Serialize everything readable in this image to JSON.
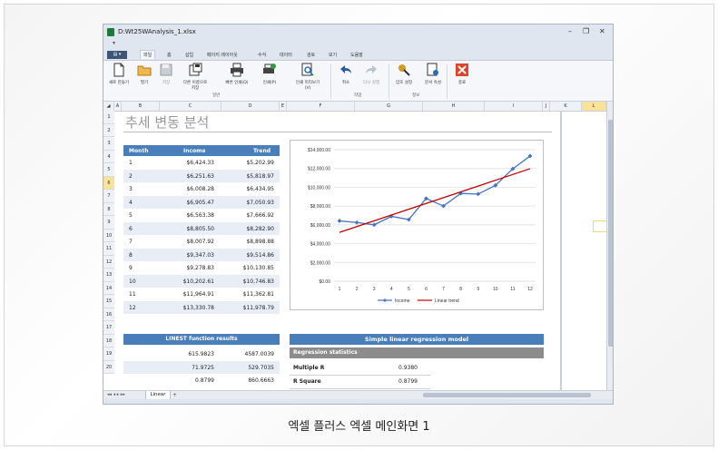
{
  "window": {
    "title": "D:Wt25WAnalysis_1.xlsx",
    "controls": [
      "–",
      "❐",
      "✕"
    ]
  },
  "qat_label": "▾",
  "tabs": {
    "file": "▤ ▾",
    "items": [
      "파일",
      "홈",
      "삽입",
      "페이지 레이아웃",
      "수식",
      "데이터",
      "검토",
      "보기",
      "도움말"
    ],
    "active_index": 0
  },
  "ribbon": {
    "buttons": [
      {
        "label": "새로 만들기",
        "icon": "new-document-icon"
      },
      {
        "label": "열기",
        "icon": "folder-open-icon"
      },
      {
        "label": "저장",
        "icon": "save-icon"
      },
      {
        "label": "다른 이름으로 저장",
        "icon": "save-as-icon"
      },
      {
        "label": "빠른 인쇄(Q)",
        "icon": "printer-icon"
      },
      {
        "label": "인쇄(P)",
        "icon": "print-settings-icon"
      },
      {
        "label": "인쇄 미리보기(V)",
        "icon": "print-preview-icon"
      },
      {
        "label": "취소",
        "icon": "undo-icon"
      },
      {
        "label": "다시 실행",
        "icon": "redo-icon"
      },
      {
        "label": "암호 설정",
        "icon": "password-key-icon"
      },
      {
        "label": "문서 속성",
        "icon": "document-properties-icon"
      },
      {
        "label": "종료",
        "icon": "close-app-icon"
      }
    ],
    "groups": [
      "일반",
      "작업",
      "정보"
    ]
  },
  "columns": [
    "A",
    "B",
    "C",
    "D",
    "E",
    "F",
    "G",
    "H",
    "I",
    "J",
    "K",
    "L"
  ],
  "selected_column": "L",
  "rows": [
    "1",
    "2",
    "3",
    "4",
    "5",
    "6",
    "7",
    "8",
    "9",
    "10",
    "11",
    "12",
    "13",
    "14",
    "15",
    "16",
    "17",
    "18",
    "19",
    "20"
  ],
  "selected_row": "6",
  "sheet_title": "추세 변동 분석",
  "data_table": {
    "headers": [
      "Month",
      "Income",
      "Trend"
    ],
    "rows": [
      [
        "1",
        "$6,424.33",
        "$5,202.99"
      ],
      [
        "2",
        "$6,251.63",
        "$5,818.97"
      ],
      [
        "3",
        "$6,008.28",
        "$6,434.95"
      ],
      [
        "4",
        "$6,905.47",
        "$7,050.93"
      ],
      [
        "5",
        "$6,563.38",
        "$7,666.92"
      ],
      [
        "6",
        "$8,805.50",
        "$8,282.90"
      ],
      [
        "7",
        "$8,007.92",
        "$8,898.88"
      ],
      [
        "8",
        "$9,347.03",
        "$9,514.86"
      ],
      [
        "9",
        "$9,278.83",
        "$10,130.85"
      ],
      [
        "10",
        "$10,202.61",
        "$10,746.83"
      ],
      [
        "11",
        "$11,964.91",
        "$11,362.81"
      ],
      [
        "12",
        "$13,330.78",
        "$11,978.79"
      ]
    ]
  },
  "linest": {
    "title": "LINEST function results",
    "rows": [
      [
        "615.9823",
        "4587.0039"
      ],
      [
        "71.9725",
        "529.7035"
      ],
      [
        "0.8799",
        "860.6663"
      ]
    ]
  },
  "regression": {
    "title": "Simple linear regression model",
    "subtitle": "Regression statistics",
    "rows": [
      {
        "label": "Multiple R",
        "value": "0.9380"
      },
      {
        "label": "R Square",
        "value": "0.8799"
      }
    ]
  },
  "sheet_tabs": {
    "nav": "◂◂ ◂ ▸ ▸▸",
    "active": "Linear",
    "add": "+"
  },
  "chart_data": {
    "type": "line",
    "x": [
      1,
      2,
      3,
      4,
      5,
      6,
      7,
      8,
      9,
      10,
      11,
      12
    ],
    "series": [
      {
        "name": "Income",
        "color": "#4472c4",
        "marker": "diamond",
        "values": [
          6424.33,
          6251.63,
          6008.28,
          6905.47,
          6563.38,
          8805.5,
          8007.92,
          9347.03,
          9278.83,
          10202.61,
          11964.91,
          13330.78
        ]
      },
      {
        "name": "Linear trend",
        "color": "#c00000",
        "marker": "none",
        "values": [
          5202.99,
          5818.97,
          6434.95,
          7050.93,
          7666.92,
          8282.9,
          8898.88,
          9514.86,
          10130.85,
          10746.83,
          11362.81,
          11978.79
        ]
      }
    ],
    "ylim": [
      0,
      14000
    ],
    "yticks": [
      "$0.00",
      "$2,000.00",
      "$4,000.00",
      "$6,000.00",
      "$8,000.00",
      "$10,000.00",
      "$12,000.00",
      "$14,000.00"
    ],
    "xticks": [
      "1",
      "2",
      "3",
      "4",
      "5",
      "6",
      "7",
      "8",
      "9",
      "10",
      "11",
      "12"
    ],
    "grid": true,
    "legend": "bottom"
  },
  "caption": "엑셀 플러스 엑셀 메인화면 1"
}
